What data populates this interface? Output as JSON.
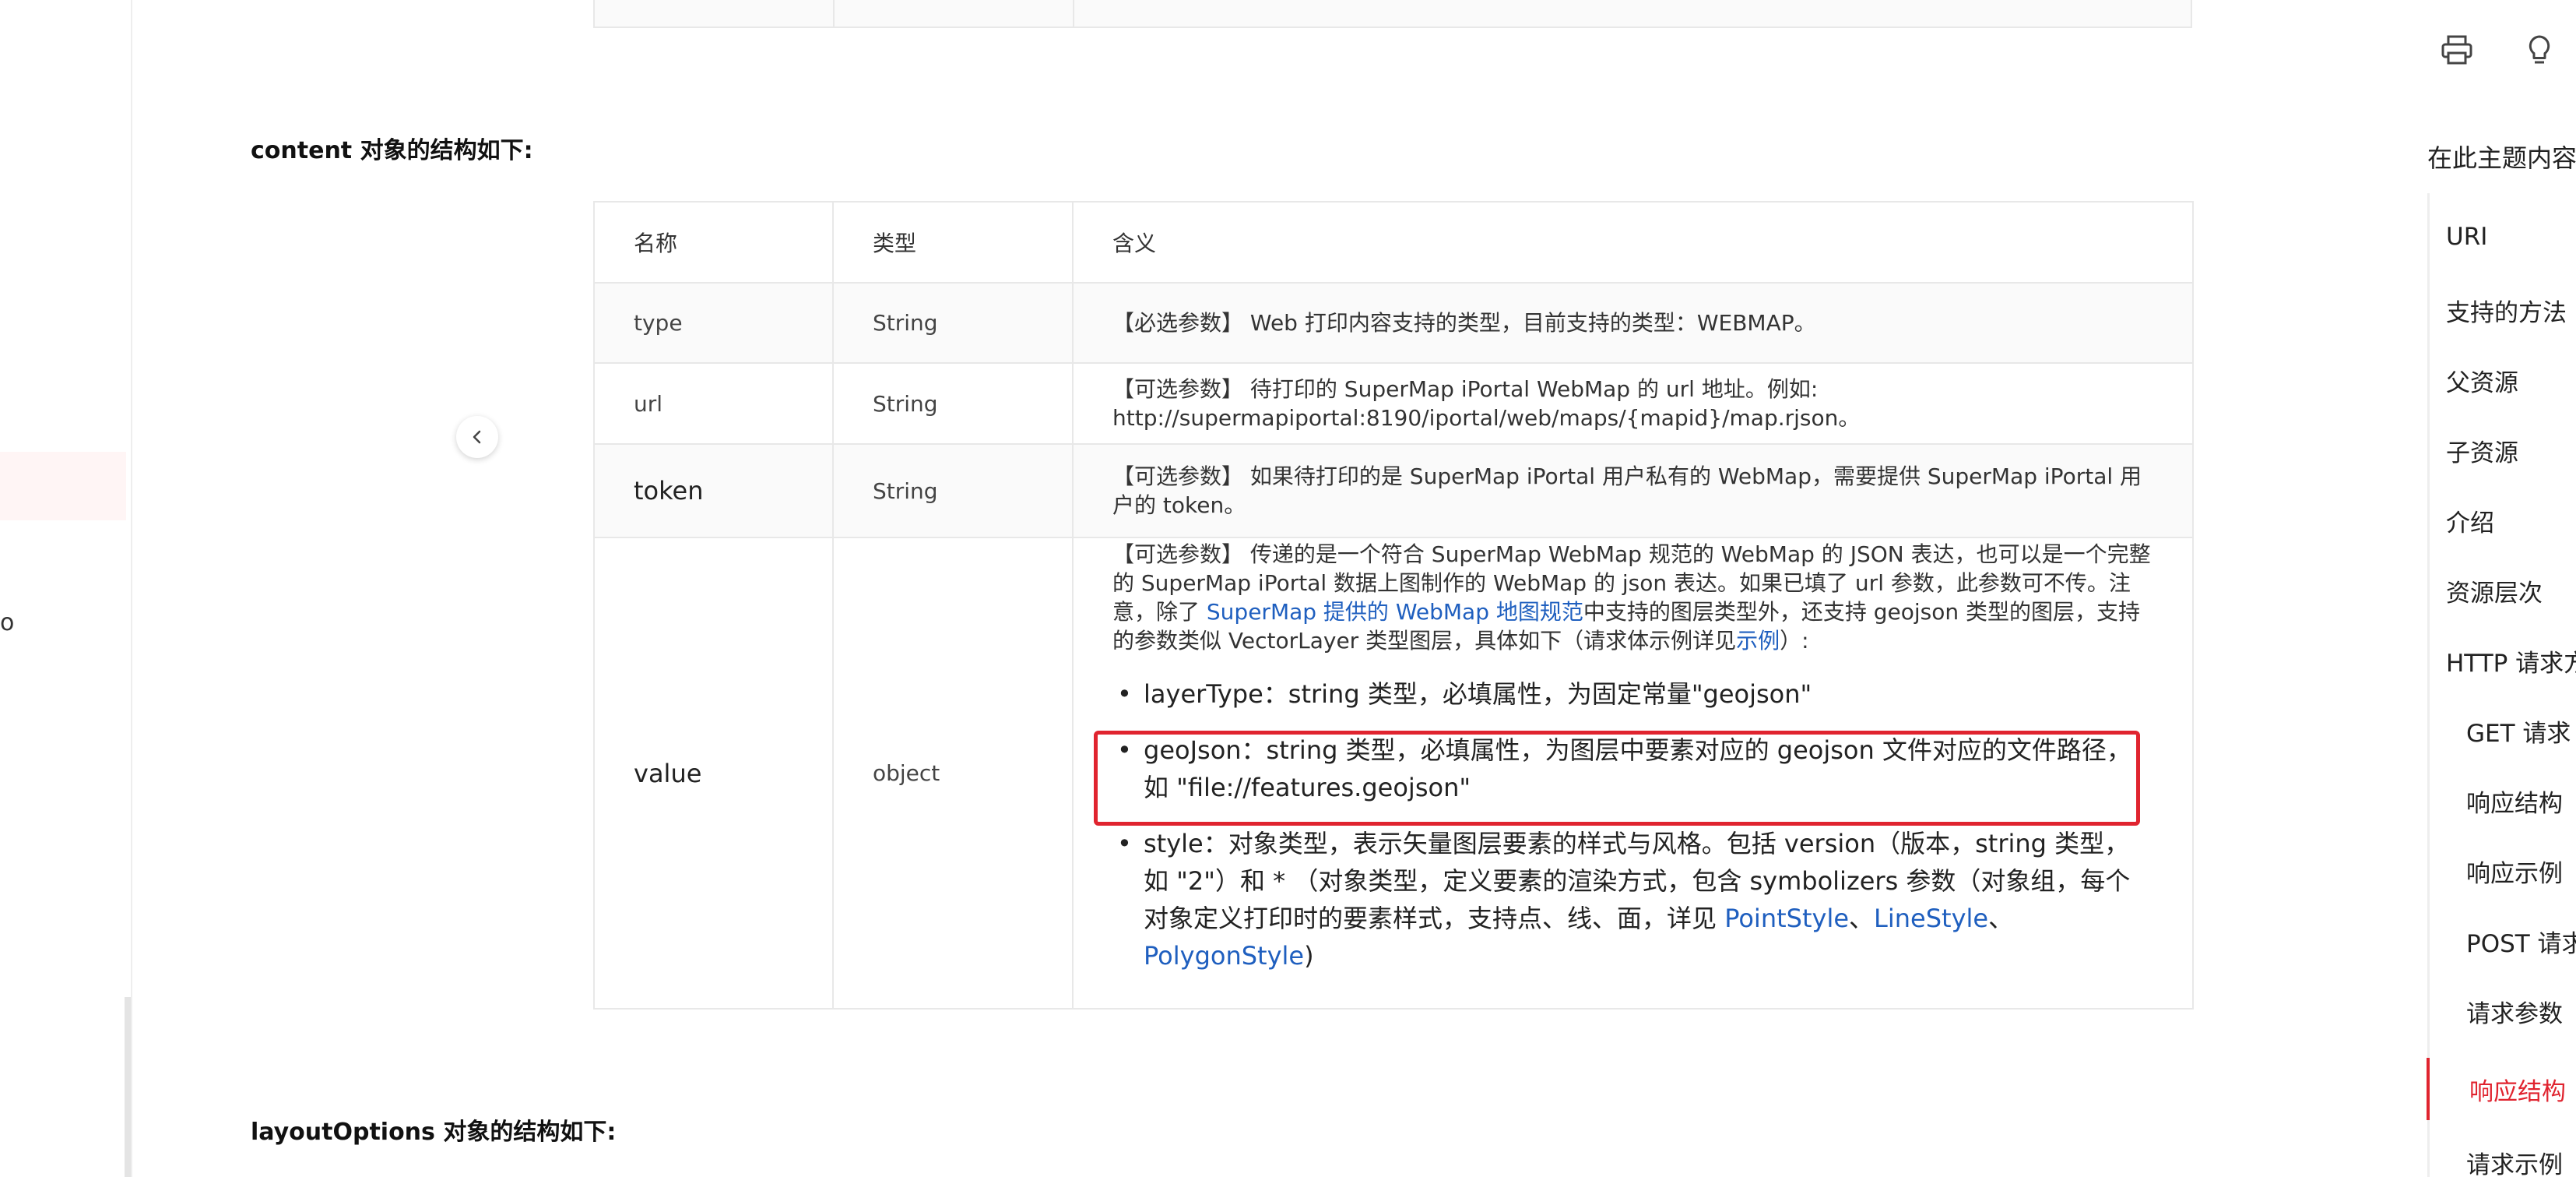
{
  "left_nav": {
    "fragment": "o"
  },
  "sections": {
    "content_title": "content 对象的结构如下:",
    "layout_title": "layoutOptions 对象的结构如下:"
  },
  "table": {
    "headers": [
      "名称",
      "类型",
      "含义"
    ],
    "rows": [
      {
        "name": "type",
        "type": "String",
        "meaning": "【必选参数】 Web 打印内容支持的类型，目前支持的类型：WEBMAP。"
      },
      {
        "name": "url",
        "type": "String",
        "meaning_line1": "【可选参数】 待打印的 SuperMap iPortal WebMap 的 url 地址。例如:",
        "meaning_line2": "http://supermapiportal:8190/iportal/web/maps/{mapid}/map.rjson。"
      },
      {
        "name": "token",
        "type": "String",
        "meaning": "【可选参数】 如果待打印的是 SuperMap iPortal 用户私有的 WebMap，需要提供 SuperMap iPortal 用户的 token。"
      },
      {
        "name": "value",
        "type": "object",
        "desc_part1": "【可选参数】 传递的是一个符合 SuperMap WebMap 规范的 WebMap 的 JSON 表达，也可以是一个完整的 SuperMap iPortal 数据上图制作的 WebMap 的 json 表达。如果已填了 url 参数，此参数可不传。注意，除了 ",
        "desc_link1": "SuperMap 提供的 WebMap 地图规范",
        "desc_part2": "中支持的图层类型外，还支持 geojson 类型的图层，支持的参数类似 VectorLayer 类型图层，具体如下（请求体示例详见",
        "desc_link2": "示例",
        "desc_part3": "）:",
        "bullet1": "layerType：string 类型，必填属性，为固定常量\"geojson\"",
        "bullet2": "geoJson：string 类型，必填属性，为图层中要素对应的 geojson 文件对应的文件路径，如 \"file://features.geojson\"",
        "bullet3_text": "style：对象类型，表示矢量图层要素的样式与风格。包括 version（版本，string 类型，如 \"2\"）和 * （对象类型，定义要素的渲染方式，包含 symbolizers 参数（对象组，每个对象定义打印时的要素样式，支持点、线、面，详见 ",
        "bullet3_link1": "PointStyle",
        "bullet3_sep1": "、",
        "bullet3_link2": "LineStyle",
        "bullet3_sep2": "、",
        "bullet3_link3": "PolygonStyle",
        "bullet3_end": ")"
      }
    ]
  },
  "toc": {
    "title": "在此主题内容",
    "items": [
      {
        "label": "URI",
        "indent": false,
        "active": false
      },
      {
        "label": "支持的方法",
        "indent": false,
        "active": false
      },
      {
        "label": "父资源",
        "indent": false,
        "active": false
      },
      {
        "label": "子资源",
        "indent": false,
        "active": false
      },
      {
        "label": "介绍",
        "indent": false,
        "active": false
      },
      {
        "label": "资源层次",
        "indent": false,
        "active": false
      },
      {
        "label": "HTTP 请求方",
        "indent": false,
        "active": false
      },
      {
        "label": "GET 请求",
        "indent": true,
        "active": false
      },
      {
        "label": "响应结构",
        "indent": true,
        "active": false
      },
      {
        "label": "响应示例",
        "indent": true,
        "active": false
      },
      {
        "label": "POST 请求",
        "indent": true,
        "active": false
      },
      {
        "label": "请求参数",
        "indent": true,
        "active": false
      },
      {
        "label": "响应结构",
        "indent": true,
        "active": true
      },
      {
        "label": "请求示例",
        "indent": true,
        "active": false
      }
    ]
  },
  "icons": [
    "print-icon",
    "lightbulb-icon",
    "chevron-left-icon"
  ],
  "colors": {
    "accent": "#e0242f",
    "link": "#1f5fbf",
    "highlight_box": "#e0242f"
  }
}
